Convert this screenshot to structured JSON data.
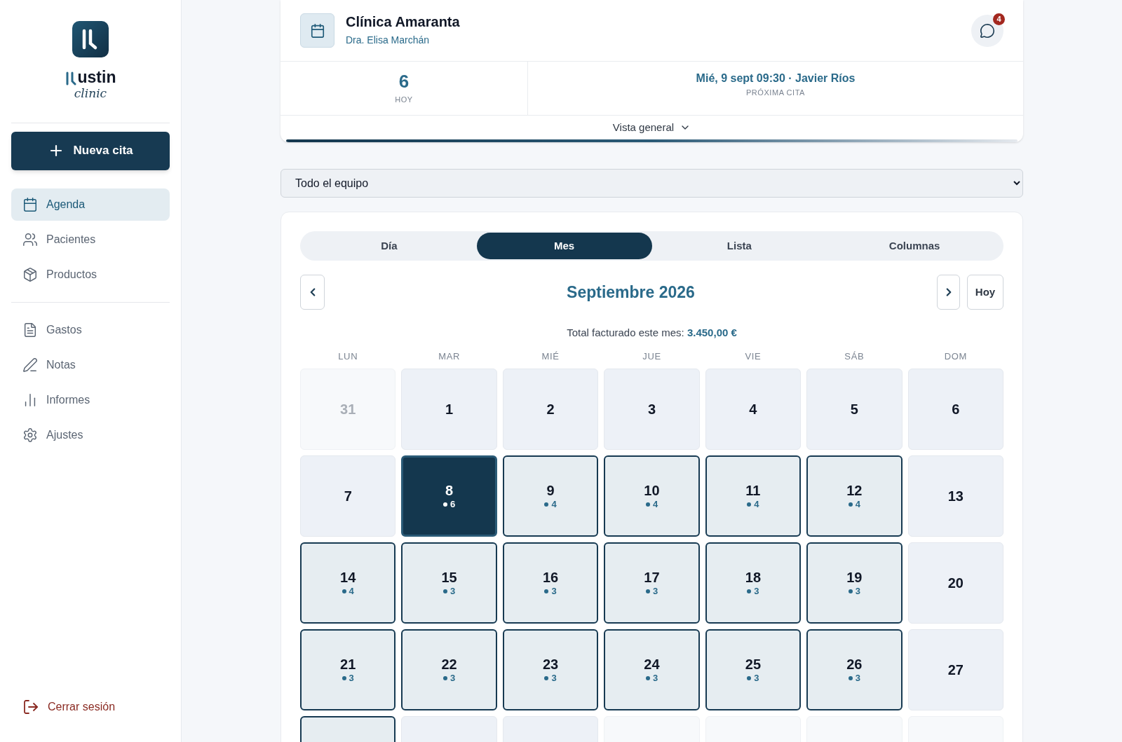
{
  "brand": {
    "name": "ustin",
    "tagline": "clinic"
  },
  "new_button": "Nueva cita",
  "nav": [
    {
      "label": "Agenda",
      "selected": true
    },
    {
      "label": "Pacientes",
      "selected": false
    },
    {
      "label": "Productos",
      "selected": false
    },
    {
      "label": "Gastos",
      "selected": false
    },
    {
      "label": "Notas",
      "selected": false
    },
    {
      "label": "Informes",
      "selected": false
    },
    {
      "label": "Ajustes",
      "selected": false
    }
  ],
  "logout": "Cerrar sesión",
  "header": {
    "clinic": "Clínica Amaranta",
    "doctor": "Dra. Elisa Marchán",
    "messages_badge": "4"
  },
  "stats": {
    "today_value": "6",
    "today_label": "HOY",
    "next_value": "Mié, 9 sept 09:30 · Javier Ríos",
    "next_label": "PRÓXIMA CITA"
  },
  "overview": "Vista general",
  "team_select": "Todo el equipo",
  "view_tabs": [
    {
      "label": "Día",
      "selected": false
    },
    {
      "label": "Mes",
      "selected": true
    },
    {
      "label": "Lista",
      "selected": false
    },
    {
      "label": "Columnas",
      "selected": false
    }
  ],
  "month": "Septiembre 2026",
  "today_button": "Hoy",
  "total": {
    "label": "Total facturado este mes:",
    "value": "3.450,00 €"
  },
  "weekdays": [
    "LUN",
    "MAR",
    "MIÉ",
    "JUE",
    "VIE",
    "SÁB",
    "DOM"
  ],
  "days": [
    {
      "day": "31",
      "kind": "outside"
    },
    {
      "day": "1",
      "kind": "normal"
    },
    {
      "day": "2",
      "kind": "normal"
    },
    {
      "day": "3",
      "kind": "normal"
    },
    {
      "day": "4",
      "kind": "normal"
    },
    {
      "day": "5",
      "kind": "normal"
    },
    {
      "day": "6",
      "kind": "normal"
    },
    {
      "day": "7",
      "kind": "normal"
    },
    {
      "day": "8",
      "kind": "selected",
      "count": "6"
    },
    {
      "day": "9",
      "kind": "booked",
      "count": "4"
    },
    {
      "day": "10",
      "kind": "booked",
      "count": "4"
    },
    {
      "day": "11",
      "kind": "booked",
      "count": "4"
    },
    {
      "day": "12",
      "kind": "booked",
      "count": "4"
    },
    {
      "day": "13",
      "kind": "normal"
    },
    {
      "day": "14",
      "kind": "booked",
      "count": "4"
    },
    {
      "day": "15",
      "kind": "booked",
      "count": "3"
    },
    {
      "day": "16",
      "kind": "booked",
      "count": "3"
    },
    {
      "day": "17",
      "kind": "booked",
      "count": "3"
    },
    {
      "day": "18",
      "kind": "booked",
      "count": "3"
    },
    {
      "day": "19",
      "kind": "booked",
      "count": "3"
    },
    {
      "day": "20",
      "kind": "normal"
    },
    {
      "day": "21",
      "kind": "booked",
      "count": "3"
    },
    {
      "day": "22",
      "kind": "booked",
      "count": "3"
    },
    {
      "day": "23",
      "kind": "booked",
      "count": "3"
    },
    {
      "day": "24",
      "kind": "booked",
      "count": "3"
    },
    {
      "day": "25",
      "kind": "booked",
      "count": "3"
    },
    {
      "day": "26",
      "kind": "booked",
      "count": "3"
    },
    {
      "day": "27",
      "kind": "normal"
    },
    {
      "kind": "booked"
    },
    {
      "kind": "normal"
    },
    {
      "kind": "normal"
    },
    {
      "kind": "outside"
    },
    {
      "kind": "outside"
    },
    {
      "kind": "outside"
    },
    {
      "kind": "outside"
    }
  ]
}
